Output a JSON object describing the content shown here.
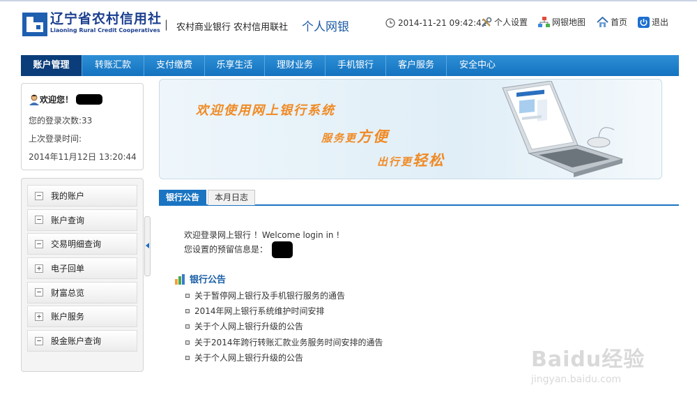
{
  "header": {
    "brand_cn": "辽宁省农村信用社",
    "brand_en": "Liaoning Rural Credit Cooperatives",
    "separator": "|",
    "subtitle": "农村商业银行  农村信用联社",
    "title": "个人网银",
    "datetime": "2014-11-21 09:42:42",
    "links": [
      {
        "label": "个人设置",
        "icon": "tools-icon"
      },
      {
        "label": "网银地图",
        "icon": "sitemap-icon"
      },
      {
        "label": "首页",
        "icon": "home-icon"
      },
      {
        "label": "退出",
        "icon": "power-icon"
      }
    ],
    "brand_color": "#1b3f8f"
  },
  "nav": {
    "active_index": 0,
    "items": [
      "账户管理",
      "转账汇款",
      "支付缴费",
      "乐享生活",
      "理财业务",
      "手机银行",
      "客户服务",
      "安全中心"
    ]
  },
  "welcome": {
    "greeting": "欢迎您！",
    "login_count": "您的登录次数:33",
    "last_login_label": "上次登录时间:",
    "last_login_time": "2014年11月12日  13:20:44"
  },
  "menu": {
    "items": [
      {
        "label": "我的账户",
        "state": "−"
      },
      {
        "label": "账户查询",
        "state": "−"
      },
      {
        "label": "交易明细查询",
        "state": "−"
      },
      {
        "label": "电子回单",
        "state": "+"
      },
      {
        "label": "财富总览",
        "state": "−"
      },
      {
        "label": "账户服务",
        "state": "+"
      },
      {
        "label": "股金账户查询",
        "state": "−"
      }
    ]
  },
  "banner": {
    "line1": "欢迎使用网上银行系统",
    "line2_prefix": "服务更",
    "line2_big": "方便",
    "line3_prefix": "出行更",
    "line3_big": "轻松"
  },
  "tabs": [
    {
      "label": "银行公告",
      "active": true
    },
    {
      "label": "本月日志",
      "active": false
    }
  ],
  "content": {
    "welcome_msg": "欢迎登录网上银行 ！Welcome login in !",
    "reserved_info_label": "您设置的预留信息是："
  },
  "notices": {
    "heading": "银行公告",
    "items": [
      "关于暂停网上银行及手机银行服务的通告",
      "2014年网上银行系统维护时间安排",
      "关于个人网上银行升级的公告",
      "关于2014年跨行转账汇款业务服务时间安排的通告",
      "关于个人网上银行升级的公告"
    ]
  },
  "watermark": {
    "main": "Baidu经验",
    "sub": "jingyan.baidu.com"
  }
}
